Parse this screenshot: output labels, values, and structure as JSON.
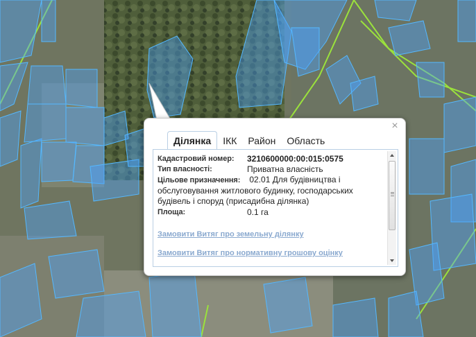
{
  "popup": {
    "close_glyph": "×",
    "tabs": [
      {
        "label": "Ділянка",
        "active": true
      },
      {
        "label": "ІКК",
        "active": false
      },
      {
        "label": "Район",
        "active": false
      },
      {
        "label": "Область",
        "active": false
      }
    ],
    "fields": {
      "cadastral_label": "Кадастровий номер:",
      "cadastral_value": "3210600000:00:015:0575",
      "ownership_label": "Тип власності:",
      "ownership_value": "Приватна власність",
      "purpose_label": "Цільове призначення:",
      "purpose_value": "02.01 Для будівництва і обслуговування житлового будинку, господарських будівель і споруд (присадибна ділянка)",
      "area_label": "Площа:",
      "area_value": "0.1 га"
    },
    "links": {
      "land_extract": "Замовити Витяг про земельну ділянку",
      "valuation_extract": "Замовити Витяг про нормативну грошову оцінку"
    },
    "colors": {
      "parcel_fill": "#4aa3ff",
      "parcel_stroke": "#55b8ff",
      "road_line": "#9be23c",
      "link": "#8aa9cf"
    }
  }
}
